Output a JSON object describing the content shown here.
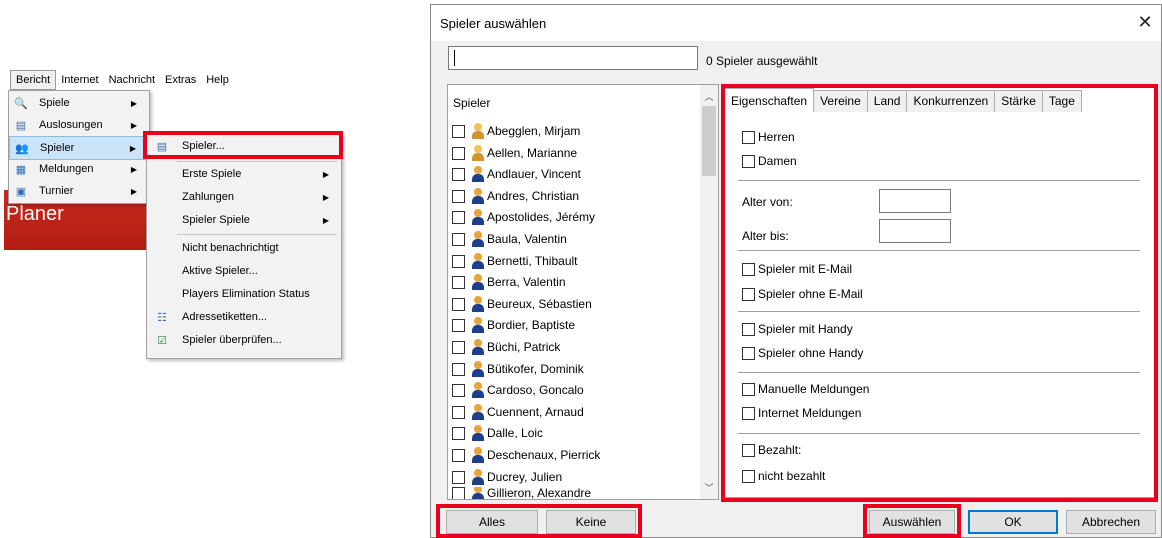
{
  "menubar": {
    "items": [
      "Bericht",
      "Internet",
      "Nachricht",
      "Extras",
      "Help"
    ]
  },
  "banner": {
    "text": "Planer"
  },
  "menu_bericht": {
    "items": [
      {
        "label": "Spiele",
        "icon": "magnifier-icon",
        "submenu": true
      },
      {
        "label": "Auslosungen",
        "icon": "draw-document-icon",
        "submenu": true
      },
      {
        "label": "Spieler",
        "icon": "players-icon",
        "submenu": true,
        "highlighted": true
      },
      {
        "label": "Meldungen",
        "icon": "entries-icon",
        "submenu": true
      },
      {
        "label": "Turnier",
        "icon": "tournament-icon",
        "submenu": true
      }
    ]
  },
  "menu_spieler": {
    "items": [
      {
        "label": "Spieler...",
        "icon": "player-list-icon",
        "submenu": false
      },
      {
        "label": "Erste Spiele",
        "submenu": true
      },
      {
        "label": "Zahlungen",
        "submenu": true
      },
      {
        "label": "Spieler Spiele",
        "submenu": true
      },
      {
        "label": "Nicht benachrichtigt",
        "submenu": false
      },
      {
        "label": "Aktive Spieler...",
        "submenu": false
      },
      {
        "label": "Players Elimination Status",
        "submenu": false
      },
      {
        "label": "Adressetiketten...",
        "icon": "labels-icon",
        "submenu": false
      },
      {
        "label": "Spieler überprüfen...",
        "icon": "check-icon",
        "submenu": false
      }
    ]
  },
  "dialog": {
    "title": "Spieler auswählen",
    "search_value": "",
    "selected_count": "0 Spieler ausgewählt",
    "list_header": "Spieler",
    "players": [
      {
        "name": "Abegglen, Mirjam",
        "gender": "f"
      },
      {
        "name": "Aellen, Marianne",
        "gender": "f"
      },
      {
        "name": "Andlauer, Vincent",
        "gender": "m"
      },
      {
        "name": "Andres, Christian",
        "gender": "m"
      },
      {
        "name": "Apostolides, Jérémy",
        "gender": "m"
      },
      {
        "name": "Baula, Valentin",
        "gender": "m"
      },
      {
        "name": "Bernetti, Thibault",
        "gender": "m"
      },
      {
        "name": "Berra, Valentin",
        "gender": "m"
      },
      {
        "name": "Beureux, Sébastien",
        "gender": "m"
      },
      {
        "name": "Bordier, Baptiste",
        "gender": "m"
      },
      {
        "name": "Büchi, Patrick",
        "gender": "m"
      },
      {
        "name": "Bütikofer, Dominik",
        "gender": "m"
      },
      {
        "name": "Cardoso, Goncalo",
        "gender": "m"
      },
      {
        "name": "Cuennent, Arnaud",
        "gender": "m"
      },
      {
        "name": "Dalle, Loic",
        "gender": "m"
      },
      {
        "name": "Deschenaux, Pierrick",
        "gender": "m"
      },
      {
        "name": "Ducrey, Julien",
        "gender": "m"
      },
      {
        "name": "Gillieron, Alexandre",
        "gender": "m"
      }
    ],
    "tabs": [
      "Eigenschaften",
      "Vereine",
      "Land",
      "Konkurrenzen",
      "Stärke",
      "Tage"
    ],
    "active_tab": "Eigenschaften",
    "filters": {
      "herren": "Herren",
      "damen": "Damen",
      "alter_von": "Alter von:",
      "alter_bis": "Alter bis:",
      "mit_email": "Spieler mit E-Mail",
      "ohne_email": "Spieler ohne E-Mail",
      "mit_handy": "Spieler mit Handy",
      "ohne_handy": "Spieler ohne Handy",
      "manuelle": "Manuelle Meldungen",
      "internet": "Internet Meldungen",
      "bezahlt": "Bezahlt:",
      "nicht_bezahlt": "nicht bezahlt"
    },
    "buttons": {
      "alles": "Alles",
      "keine": "Keine",
      "auswaehlen": "Auswählen",
      "ok": "OK",
      "abbrechen": "Abbrechen"
    }
  },
  "colors": {
    "highlight_box": "#e8001c",
    "menu_hover": "#cce4f7",
    "banner": "#c8291d",
    "ok_border": "#0078d7"
  }
}
